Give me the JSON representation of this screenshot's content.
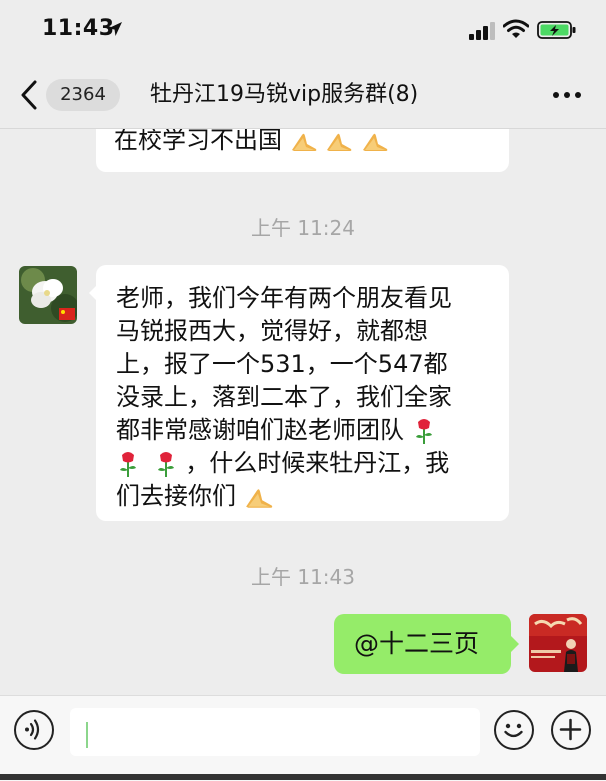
{
  "status_bar": {
    "time": "11:43",
    "battery_color": "#4cd964"
  },
  "nav": {
    "unread_count": "2364",
    "title": "牡丹江19马锐vip服务群(8)"
  },
  "messages": {
    "prev_tail_text": "在校学习不出国",
    "timestamp_1": "上午 11:24",
    "main_lines": [
      "老师，我们今年有两个朋友看见",
      "马锐报西大，觉得好，就都想",
      "上，报了一个531，一个547都",
      "没录上，落到二本了，我们全家",
      "都非常感谢咱们赵老师团队",
      "，什么时候来牡丹江，我",
      "们去接你们"
    ],
    "timestamp_2": "上午 11:43",
    "sent_text": "@十二三页"
  },
  "colors": {
    "background": "#ededed",
    "sent_bubble": "#95ec69",
    "received_bubble": "#ffffff",
    "timestamp": "#a6a6a6"
  },
  "icons": {
    "back": "chevron-left-icon",
    "more": "more-dots-icon",
    "voice": "voice-icon",
    "emoji": "emoji-icon",
    "plus": "plus-icon"
  }
}
